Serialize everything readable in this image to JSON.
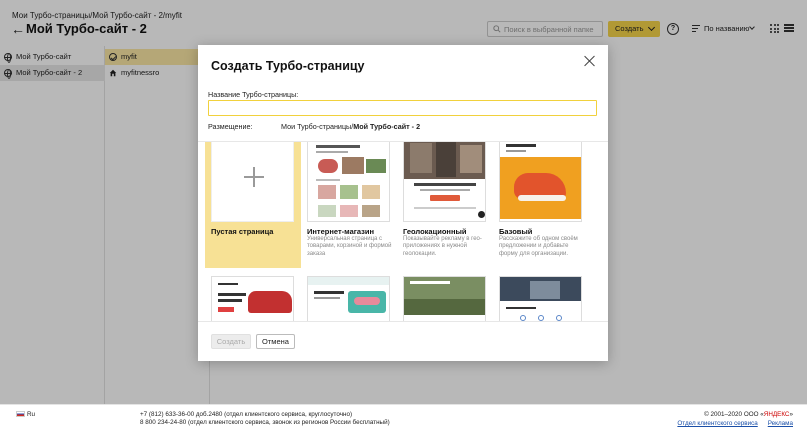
{
  "header": {
    "breadcrumb": "Мои Турбо-страницы/Мой Турбо-сайт - 2/myfit",
    "title": "Мой Турбо-сайт - 2",
    "search_placeholder": "Поиск в выбранной папке",
    "create_label": "Создать",
    "help_label": "?",
    "sort_label": "По названию"
  },
  "sidebar": {
    "items": [
      {
        "label": "Мой Турбо-сайт",
        "selected": false
      },
      {
        "label": "Мой Турбо-сайт - 2",
        "selected": true
      }
    ]
  },
  "files": {
    "items": [
      {
        "label": "myfit",
        "selected": true
      },
      {
        "label": "myfitnessro",
        "selected": false
      }
    ]
  },
  "modal": {
    "title": "Создать Турбо-страницу",
    "name_label": "Название Турбо-страницы:",
    "name_value": "",
    "placement_label": "Размещение:",
    "placement_prefix": "Мои Турбо-страницы/",
    "placement_folder": "Мой Турбо-сайт - 2",
    "templates": [
      {
        "name": "Пустая страница",
        "description": "",
        "selected": true
      },
      {
        "name": "Интернет-магазин",
        "description": "Универсальная страница с товарами, корзиной и формой заказа",
        "selected": false
      },
      {
        "name": "Геолокационный",
        "description": "Показывайте рекламу в гео-приложениях в нужной геолокации.",
        "selected": false
      },
      {
        "name": "Базовый",
        "description": "Расскажите об одном своём предложении и добавьте форму для организации.",
        "selected": false
      }
    ],
    "create_button": "Создать",
    "cancel_button": "Отмена"
  },
  "footer": {
    "lang": "Ru",
    "phone_line1": "+7 (812) 633-36-00 доб.2480 (отдел клиентского сервиса, круглосуточно)",
    "phone_line2": "8 800 234-24-80 (отдел клиентского сервиса, звонок из регионов России бесплатный)",
    "copyright_prefix": "© 2001–2020 ООО «",
    "copyright_brand": "ЯНДЕКС",
    "copyright_suffix": "»",
    "link_support": "Отдел клиентского сервиса",
    "link_ads": "Реклама"
  },
  "colors": {
    "accent_yellow": "#f6d44a",
    "selected_template": "#f7e195",
    "selected_file": "#fbe8a6"
  }
}
